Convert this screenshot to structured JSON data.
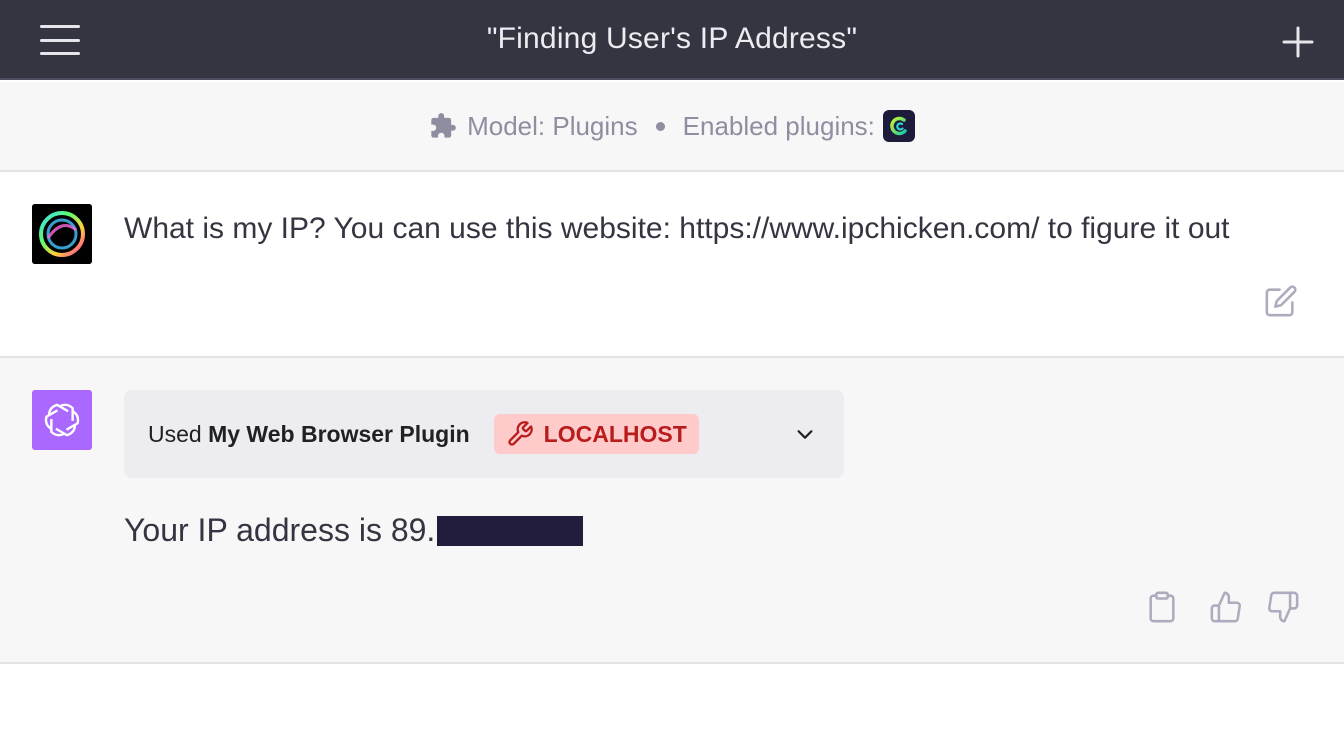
{
  "header": {
    "title": "\"Finding User's IP Address\""
  },
  "infobar": {
    "model_label": "Model: Plugins",
    "enabled_label": "Enabled plugins:"
  },
  "user_message": {
    "text": "What is my IP? You can use this website: https://www.ipchicken.com/ to figure it out"
  },
  "assistant_message": {
    "plugin_prefix": "Used ",
    "plugin_name": "My Web Browser Plugin",
    "plugin_badge": "LOCALHOST",
    "answer_text": "Your IP address is 89."
  },
  "icons": {
    "menu": "hamburger-menu-icon",
    "new_chat": "plus-icon",
    "plugins": "puzzle-icon",
    "edit": "edit-icon",
    "wrench": "wrench-icon",
    "expand": "chevron-down-icon",
    "copy": "clipboard-icon",
    "like": "thumbs-up-icon",
    "dislike": "thumbs-down-icon"
  },
  "colors": {
    "header_bg": "#343541",
    "assistant_avatar": "#ab68ff",
    "badge_bg": "#fecaca",
    "badge_text": "#b91c1c"
  }
}
